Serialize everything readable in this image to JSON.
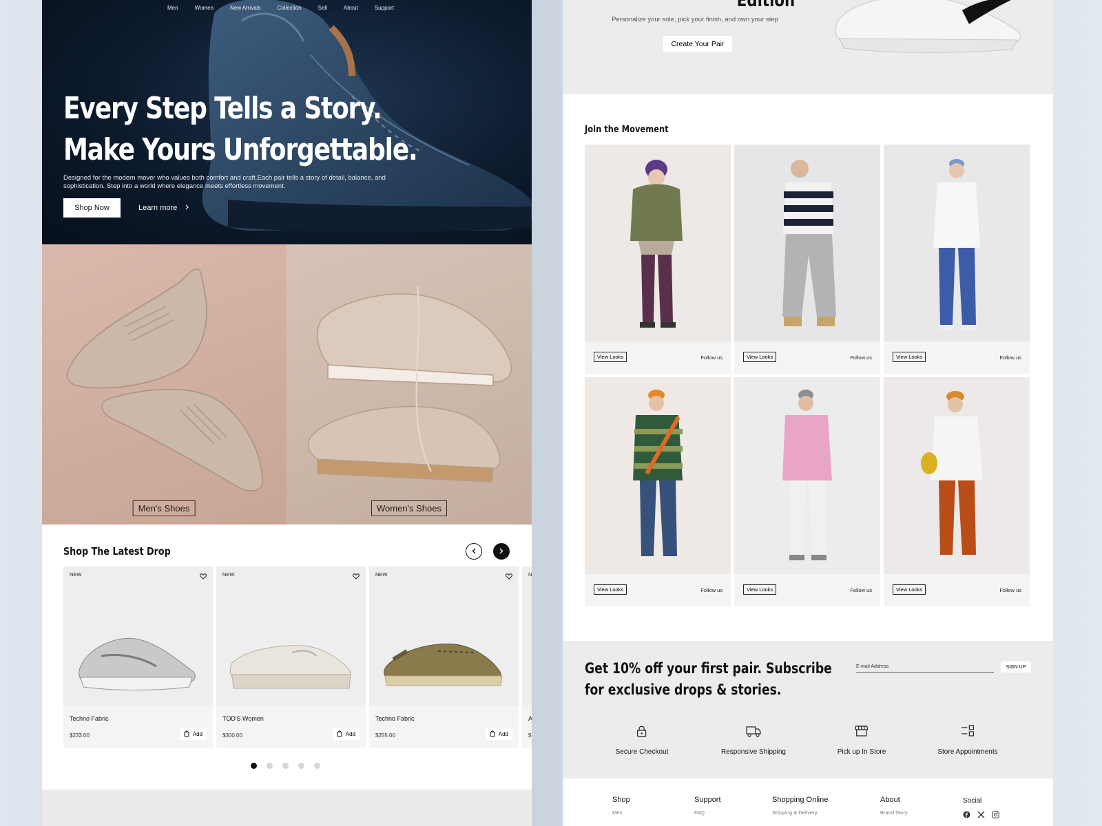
{
  "nav": {
    "items": [
      "Men",
      "Women",
      "New Arrivals",
      "Collection",
      "Sell",
      "About",
      "Support"
    ]
  },
  "hero": {
    "title_line1": "Every Step Tells a Story.",
    "title_line2": "Make Yours Unforgettable.",
    "description": "Designed for the modern mover who values both comfort and craft.Each pair tells a story of detail, balance, and sophistication. Step into a world where elegance meets effortless movement.",
    "shop_label": "Shop Now",
    "learn_label": "Learn more"
  },
  "categories": {
    "men": "Men's Shoes",
    "women": "Women's Shoes"
  },
  "latest_drop": {
    "title": "Shop The Latest Drop",
    "products": [
      {
        "badge": "NEW",
        "name": "Techno Fabric",
        "price": "$233.00",
        "add_label": "Add"
      },
      {
        "badge": "NEW",
        "name": "TOD'S Women",
        "price": "$300.00",
        "add_label": "Add"
      },
      {
        "badge": "NEW",
        "name": "Techno Fabric",
        "price": "$255.00",
        "add_label": "Add"
      },
      {
        "badge": "N",
        "name": "A",
        "price": "$",
        "add_label": ""
      }
    ],
    "pagination": {
      "pages": 5,
      "current": 1
    }
  },
  "custom": {
    "title": "Edition",
    "subtitle": "Personalize your sole, pick your finish, and own your step",
    "button": "Create Your Pair"
  },
  "join": {
    "title": "Join the Movement",
    "view_label": "View Looks",
    "follow_label": "Follow us"
  },
  "newsletter": {
    "title": "Get 10% off your first pair. Subscribe for exclusive drops & stories.",
    "email_placeholder": "E-mail Address",
    "signup_label": "SIGN UP"
  },
  "features": [
    {
      "label": "Secure Checkout",
      "icon": "lock-icon"
    },
    {
      "label": "Responsive Shipping",
      "icon": "truck-icon"
    },
    {
      "label": "Pick up In Store",
      "icon": "store-icon"
    },
    {
      "label": "Store Appointments",
      "icon": "list-icon"
    }
  ],
  "footer": {
    "columns": [
      {
        "heading": "Shop",
        "link": "Men"
      },
      {
        "heading": "Support",
        "link": "FAQ"
      },
      {
        "heading": "Shopping Online",
        "link": "Shipping & Delivery"
      },
      {
        "heading": "About",
        "link": "Brand Story"
      }
    ],
    "social_heading": "Social",
    "social_icons": [
      "facebook-icon",
      "x-icon",
      "instagram-icon"
    ]
  },
  "colors": {
    "hero_bg": "#0c1a2c",
    "tile_men": "#d0ad9d",
    "tile_women": "#cdb8ab",
    "accent": "#111111"
  }
}
